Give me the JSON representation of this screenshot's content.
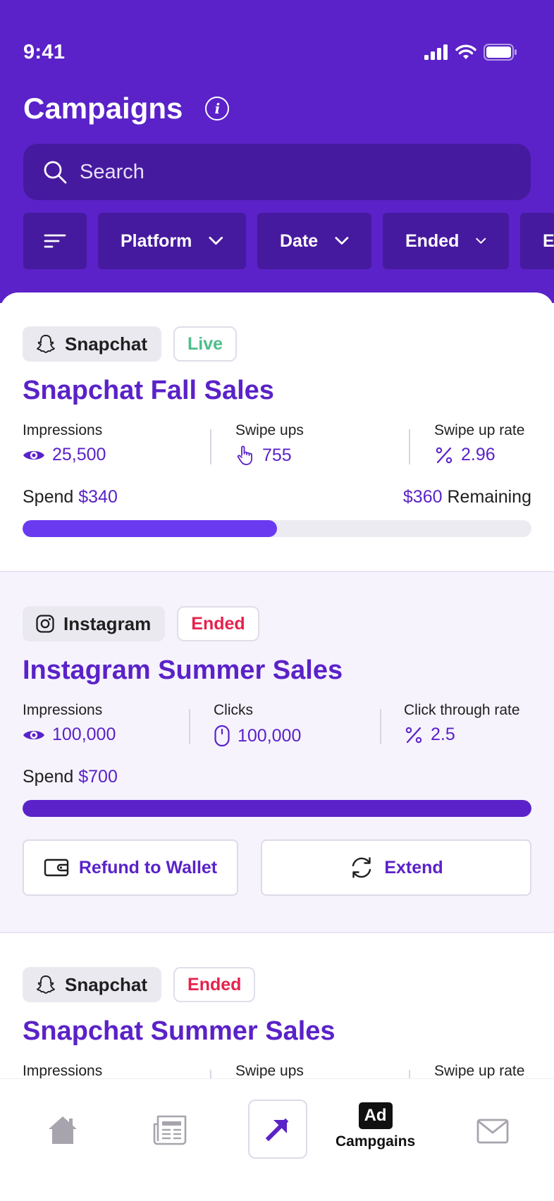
{
  "status_bar": {
    "time": "9:41"
  },
  "header": {
    "title": "Campaigns",
    "info_icon_glyph": "i",
    "search_placeholder": "Search",
    "filters": [
      {
        "label": "Platform"
      },
      {
        "label": "Date"
      },
      {
        "label": "Ended"
      },
      {
        "label": "En"
      }
    ]
  },
  "campaigns": [
    {
      "platform": "Snapchat",
      "status": "Live",
      "title": "Snapchat Fall Sales",
      "metrics": [
        {
          "label": "Impressions",
          "value": "25,500",
          "icon": "eye-icon"
        },
        {
          "label": "Swipe ups",
          "value": "755",
          "icon": "hand-pointer-icon"
        },
        {
          "label": "Swipe up rate",
          "value": "2.96",
          "icon": "percent-icon"
        }
      ],
      "spend_label": "Spend",
      "spend_value": "$340",
      "remaining_value": "$360",
      "remaining_label": "Remaining",
      "progress": 0.5,
      "colors": {
        "progress": "#6a3af0",
        "status": "#4cbf8a"
      }
    },
    {
      "platform": "Instagram",
      "status": "Ended",
      "title": "Instagram Summer Sales",
      "metrics": [
        {
          "label": "Impressions",
          "value": "100,000",
          "icon": "eye-icon"
        },
        {
          "label": "Clicks",
          "value": "100,000",
          "icon": "mouse-icon"
        },
        {
          "label": "Click through rate",
          "value": "2.5",
          "icon": "percent-icon"
        }
      ],
      "spend_label": "Spend",
      "spend_value": "$700",
      "progress": 1.0,
      "actions": {
        "refund": "Refund to Wallet",
        "extend": "Extend"
      },
      "colors": {
        "progress": "#5a22c8",
        "status": "#e6224d"
      }
    },
    {
      "platform": "Snapchat",
      "status": "Ended",
      "title": "Snapchat Summer Sales",
      "metrics": [
        {
          "label": "Impressions"
        },
        {
          "label": "Swipe ups"
        },
        {
          "label": "Swipe up rate"
        }
      ],
      "colors": {
        "status": "#e6224d"
      }
    }
  ],
  "bottom_nav": {
    "items": [
      {
        "icon": "home-icon"
      },
      {
        "icon": "newspaper-icon"
      },
      {
        "icon": "arrow-up-right-icon"
      },
      {
        "icon": "ad-icon",
        "badge": "Ad",
        "label": "Campgains",
        "active": true
      },
      {
        "icon": "mail-icon"
      }
    ]
  },
  "colors": {
    "brand": "#5a22c8",
    "header_dark": "#461a9e",
    "live": "#4cbf8a",
    "ended": "#e6224d"
  }
}
